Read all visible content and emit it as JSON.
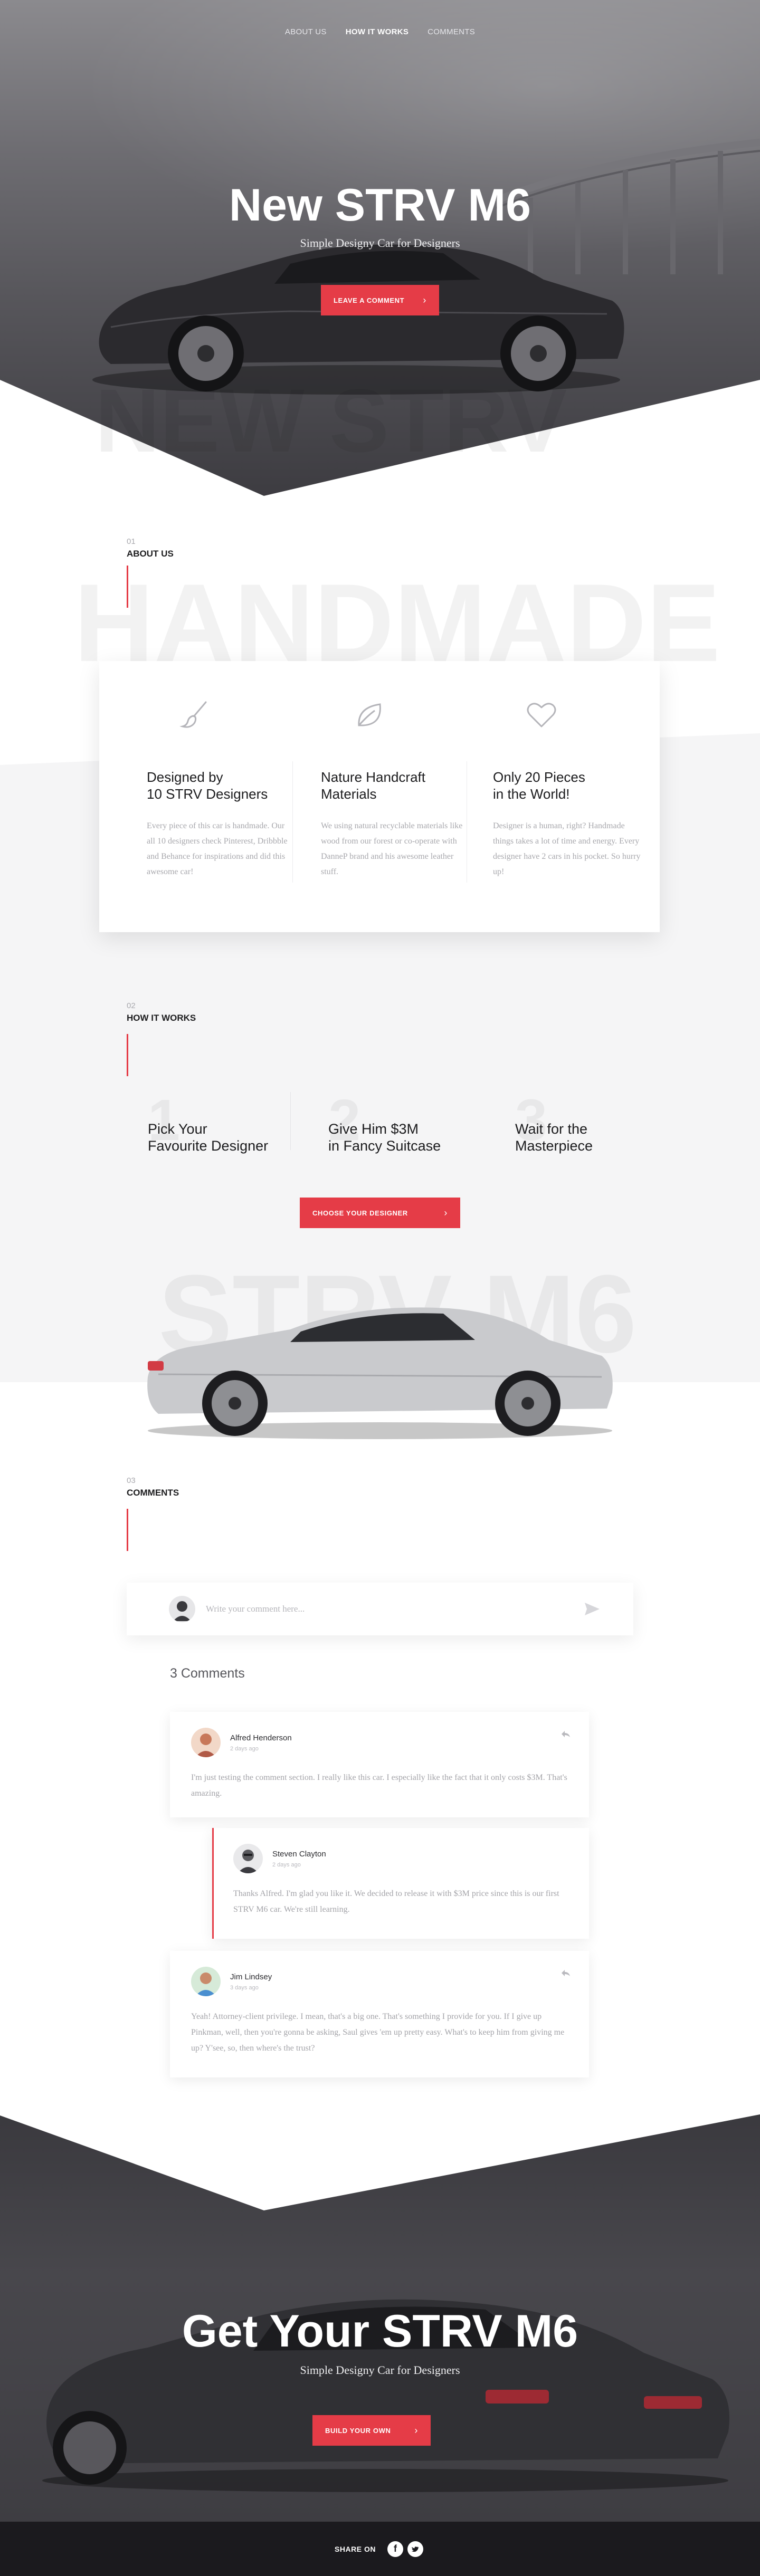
{
  "nav": {
    "items": [
      {
        "label": "ABOUT US",
        "active": false
      },
      {
        "label": "HOW IT WORKS",
        "active": true
      },
      {
        "label": "COMMENTS",
        "active": false
      }
    ]
  },
  "hero": {
    "title": "New STRV M6",
    "subtitle": "Simple Designy Car for Designers",
    "button_label": "LEAVE A COMMENT",
    "ghost_text": "NEW STRV"
  },
  "about": {
    "number": "01",
    "label": "ABOUT US",
    "ghost_text": "HANDMADE",
    "features": [
      {
        "icon": "brush-icon",
        "title": "Designed by\n10 STRV Designers",
        "text": "Every piece of this car is handmade. Our all 10 designers check Pinterest, Dribbble and Behance for inspirations and did this awesome car!"
      },
      {
        "icon": "leaf-icon",
        "title": "Nature Handcraft\nMaterials",
        "text": "We using natural recyclable materials like wood from our forest or co-operate with DanneP brand and his awesome leather stuff."
      },
      {
        "icon": "heart-icon",
        "title": "Only 20 Pieces\nin the World!",
        "text": "Designer is a human, right? Handmade things takes a lot of time and energy. Every designer have 2 cars in his pocket. So hurry up!"
      }
    ]
  },
  "how": {
    "number": "02",
    "label": "HOW IT WORKS",
    "steps": [
      {
        "num": "1",
        "title": "Pick Your\nFavourite Designer"
      },
      {
        "num": "2",
        "title": "Give Him $3M\nin Fancy Suitcase"
      },
      {
        "num": "3",
        "title": "Wait for the\nMasterpiece"
      }
    ],
    "button_label": "CHOOSE YOUR DESIGNER",
    "ghost_text": "STRV M6"
  },
  "comments": {
    "number": "03",
    "label": "COMMENTS",
    "input_placeholder": "Write your comment here...",
    "count_label": "3 Comments",
    "items": [
      {
        "name": "Alfred Henderson",
        "time": "2 days ago",
        "text": "I'm just testing the comment section. I really like this car. I especially like the fact that it only costs $3M. That's amazing.",
        "is_reply": false
      },
      {
        "name": "Steven Clayton",
        "time": "2 days ago",
        "text": "Thanks Alfred. I'm glad you like it. We decided to release it with $3M price since this is our first STRV M6 car. We're still learning.",
        "is_reply": true
      },
      {
        "name": "Jim Lindsey",
        "time": "3 days ago",
        "text": "Yeah! Attorney-client privilege. I mean, that's a big one. That's something I provide for you. If I give up Pinkman, well, then you're gonna be asking, Saul gives 'em up pretty easy. What's to keep him from giving me up? Y'see, so, then where's the trust?",
        "is_reply": false
      }
    ]
  },
  "cta": {
    "title": "Get Your STRV M6",
    "subtitle": "Simple Designy Car for Designers",
    "button_label": "BUILD YOUR OWN"
  },
  "footer": {
    "share_label": "SHARE ON",
    "socials": [
      "facebook-icon",
      "twitter-icon"
    ]
  },
  "colors": {
    "accent": "#e53c47",
    "dark": "#1b1a1e",
    "light_band": "#f5f5f6"
  }
}
